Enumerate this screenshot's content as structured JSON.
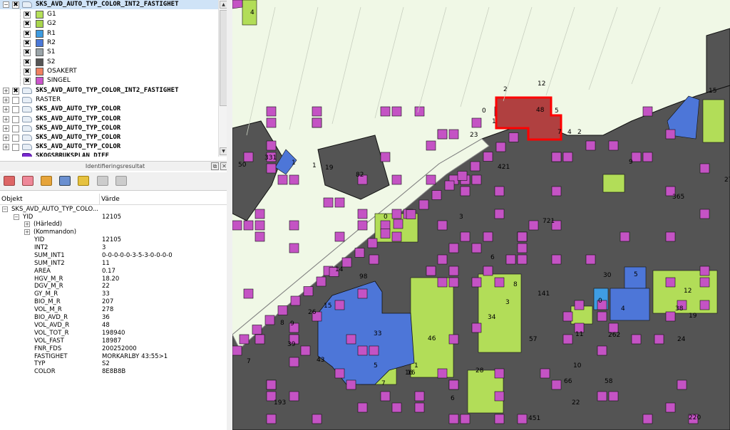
{
  "layers_panel": {
    "top_layer": "SKS_AVD_AUTO_TYP_COLOR_INT2_FASTIGHET",
    "categories": [
      {
        "label": "G1",
        "color": "#b5e05a"
      },
      {
        "label": "G2",
        "color": "#a8d64c"
      },
      {
        "label": "R1",
        "color": "#3d9be0"
      },
      {
        "label": "R2",
        "color": "#4a78d8"
      },
      {
        "label": "S1",
        "color": "#9aa4a8"
      },
      {
        "label": "S2",
        "color": "#555555"
      },
      {
        "label": "OSAKERT",
        "color": "#f08060"
      },
      {
        "label": "SINGEL",
        "color": "#cc55cc"
      }
    ],
    "other_layers": [
      "SKS_AVD_AUTO_TYP_COLOR_INT2_FASTIGHET",
      "RASTER",
      "SKS_AVD_AUTO_TYP_COLOR",
      "SKS_AVD_AUTO_TYP_COLOR",
      "SKS_AVD_AUTO_TYP_COLOR",
      "SKS_AVD_AUTO_TYP_COLOR",
      "SKS_AVD_AUTO_TYP_COLOR",
      "SKOGSBRUKSPLAN_DIFF"
    ]
  },
  "identify": {
    "title": "Identifieringsresultat",
    "col_object": "Objekt",
    "col_value": "Värde",
    "layer_row": "SKS_AVD_AUTO_TYP_COLO...",
    "feature_key": "YID",
    "feature_val": "12105",
    "derived": "(Härledd)",
    "actions": "(Kommandon)",
    "attributes": [
      {
        "k": "YID",
        "v": "12105"
      },
      {
        "k": "INT2",
        "v": "3"
      },
      {
        "k": "SUM_INT1",
        "v": "0-0-0-0-0-3-5-3-0-0-0-0"
      },
      {
        "k": "SUM_INT2",
        "v": "11"
      },
      {
        "k": "AREA",
        "v": "0.17"
      },
      {
        "k": "HGV_M_R",
        "v": "18.20"
      },
      {
        "k": "DGV_M_R",
        "v": "22"
      },
      {
        "k": "GY_M_R",
        "v": "33"
      },
      {
        "k": "BIO_M_R",
        "v": "207"
      },
      {
        "k": "VOL_M_R",
        "v": "278"
      },
      {
        "k": "BIO_AVD_R",
        "v": "36"
      },
      {
        "k": "VOL_AVD_R",
        "v": "48"
      },
      {
        "k": "VOL_TOT_R",
        "v": "198940"
      },
      {
        "k": "VOL_FAST",
        "v": "18987"
      },
      {
        "k": "FNR_FDS",
        "v": "200252000"
      },
      {
        "k": "FASTIGHET",
        "v": "MORKARLBY 43:55>1"
      },
      {
        "k": "TYP",
        "v": "S2"
      },
      {
        "k": "COLOR",
        "v": "8E8B8B"
      }
    ]
  },
  "map_labels": {
    "selected_parcel": "48",
    "stands": [
      "4",
      "12",
      "5",
      "2",
      "0",
      "1",
      "7",
      "4",
      "2",
      "23",
      "331",
      "1",
      "1",
      "19",
      "82",
      "50",
      "421",
      "721",
      "141",
      "33",
      "46",
      "34",
      "28",
      "262",
      "38",
      "30",
      "0",
      "4",
      "5",
      "16",
      "57",
      "24",
      "12",
      "19",
      "220",
      "365",
      "271",
      "6",
      "3",
      "15",
      "9",
      "193",
      "43",
      "26",
      "66",
      "58",
      "22",
      "451",
      "8",
      "14",
      "98",
      "15",
      "10",
      "9",
      "39",
      "5",
      "6",
      "8",
      "3",
      "1",
      "7",
      "0",
      "16",
      "11",
      "7"
    ]
  }
}
